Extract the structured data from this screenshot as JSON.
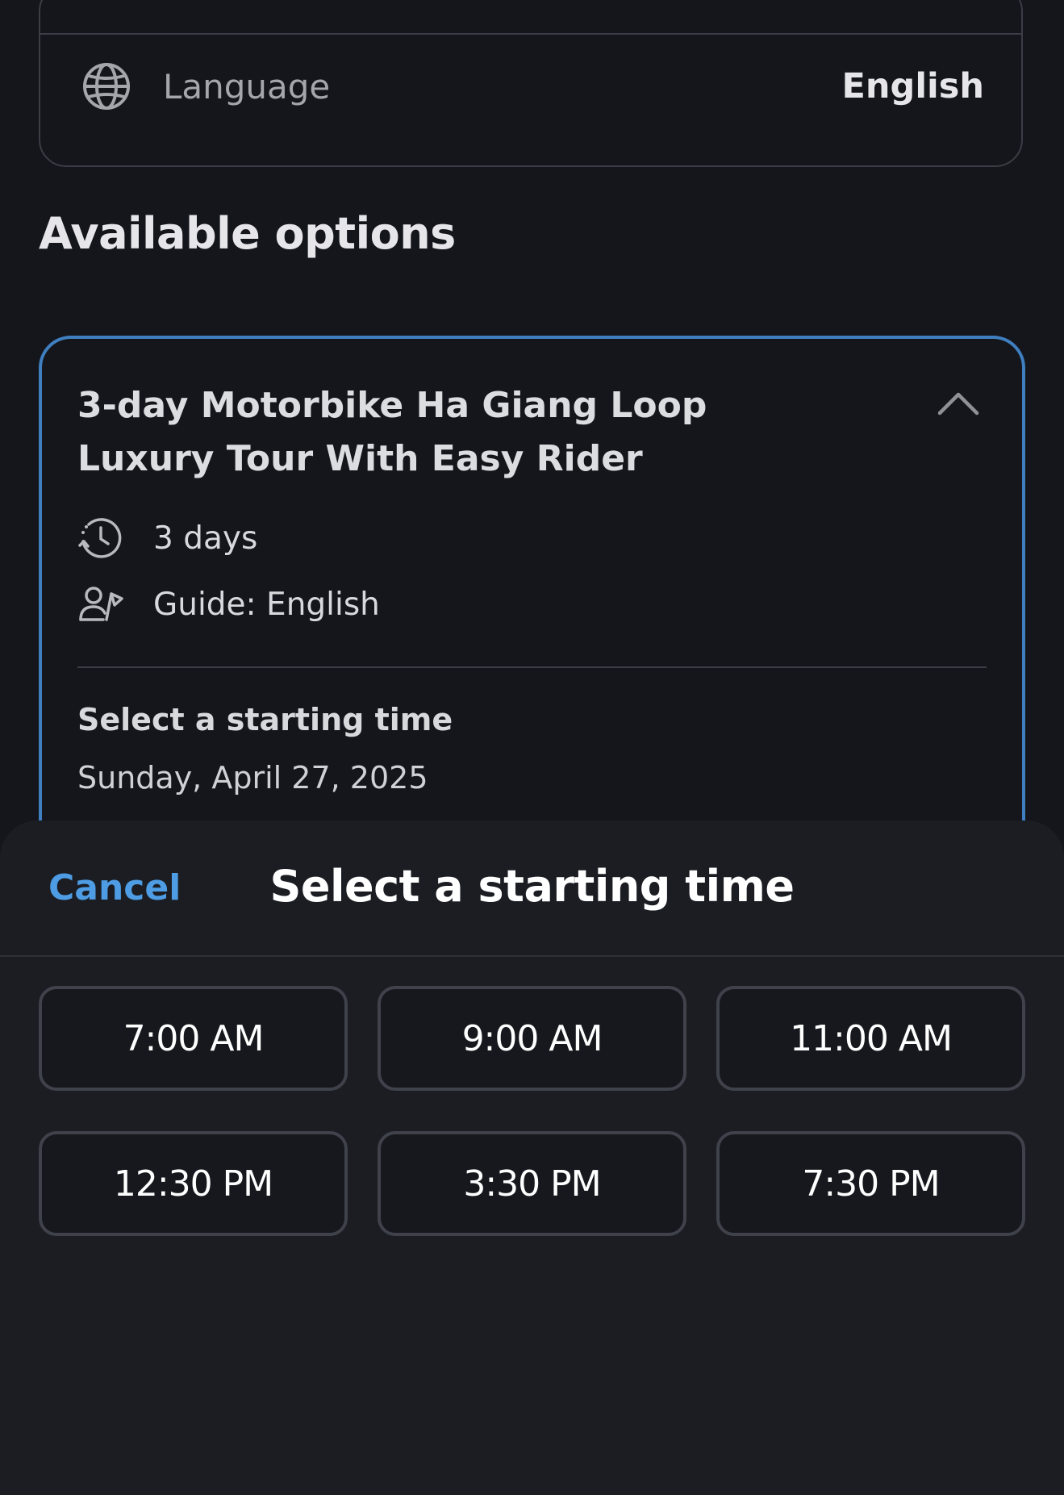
{
  "language_row": {
    "label": "Language",
    "value": "English",
    "icon": "globe-icon"
  },
  "section": {
    "title": "Available options"
  },
  "option": {
    "title": "3-day Motorbike Ha Giang Loop Luxury Tour With Easy Rider",
    "duration": "3 days",
    "guide": "Guide: English",
    "start_label": "Select a starting time",
    "date": "Sunday, April 27, 2025",
    "border_color": "#3f7fc0"
  },
  "sheet": {
    "cancel_label": "Cancel",
    "title": "Select a starting time",
    "accent_color": "#4e9ce4",
    "times": [
      "7:00 AM",
      "9:00 AM",
      "11:00 AM",
      "12:30 PM",
      "3:30 PM",
      "7:30 PM"
    ]
  }
}
